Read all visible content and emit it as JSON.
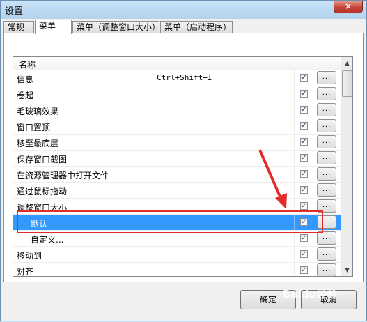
{
  "window": {
    "title": "设置",
    "close_label": "×"
  },
  "tabs": [
    {
      "label": "常规",
      "active": false
    },
    {
      "label": "菜单",
      "active": true
    },
    {
      "label": "菜单（调整窗口大小）",
      "active": false
    },
    {
      "label": "菜单（启动程序）",
      "active": false
    }
  ],
  "list": {
    "header": {
      "name": "名称"
    },
    "rows": [
      {
        "name": "信息",
        "shortcut": "Ctrl+Shift+I",
        "checked": true,
        "button": "..."
      },
      {
        "name": "卷起",
        "shortcut": "",
        "checked": true,
        "button": "..."
      },
      {
        "name": "毛玻璃效果",
        "shortcut": "",
        "checked": true,
        "button": "..."
      },
      {
        "name": "窗口置顶",
        "shortcut": "",
        "checked": true,
        "button": "..."
      },
      {
        "name": "移至最底层",
        "shortcut": "",
        "checked": true,
        "button": "..."
      },
      {
        "name": "保存窗口截图",
        "shortcut": "",
        "checked": true,
        "button": "..."
      },
      {
        "name": "在资源管理器中打开文件",
        "shortcut": "",
        "checked": true,
        "button": "..."
      },
      {
        "name": "通过鼠标拖动",
        "shortcut": "",
        "checked": true,
        "button": "..."
      },
      {
        "name": "调整窗口大小",
        "shortcut": "",
        "checked": true,
        "button": "..."
      },
      {
        "name": "默认",
        "shortcut": "",
        "checked": true,
        "button": "...",
        "selected": true,
        "sub": true
      },
      {
        "name": "自定义...",
        "shortcut": "",
        "checked": true,
        "button": "...",
        "sub": true
      },
      {
        "name": "移动到",
        "shortcut": "",
        "checked": true,
        "button": "..."
      },
      {
        "name": "对齐",
        "shortcut": "",
        "checked": true,
        "button": "..."
      }
    ]
  },
  "buttons": {
    "ok": "确定",
    "cancel": "取消"
  },
  "watermark": "Baidu经验",
  "colors": {
    "selection": "#3399ff",
    "annotation": "#e52c2c"
  }
}
